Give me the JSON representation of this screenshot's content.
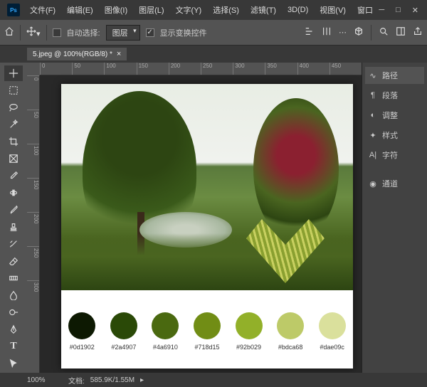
{
  "menu": [
    "文件(F)",
    "编辑(E)",
    "图像(I)",
    "图层(L)",
    "文字(Y)",
    "选择(S)",
    "滤镜(T)",
    "3D(D)",
    "视图(V)",
    "窗口"
  ],
  "optionbar": {
    "auto_select_label": "自动选择:",
    "auto_select_target": "图层",
    "show_transform_label": "显示变换控件"
  },
  "doc_tab": "5.jpeg @ 100%(RGB/8) *",
  "ruler_h": [
    "0",
    "50",
    "100",
    "150",
    "200",
    "250",
    "300",
    "350",
    "400",
    "450"
  ],
  "ruler_v": [
    "0",
    "50",
    "100",
    "150",
    "200",
    "250",
    "300"
  ],
  "palette": [
    {
      "hex": "#0d1902"
    },
    {
      "hex": "#2a4907"
    },
    {
      "hex": "#4a6910"
    },
    {
      "hex": "#718d15"
    },
    {
      "hex": "#92b029"
    },
    {
      "hex": "#bdca68"
    },
    {
      "hex": "#dae09c"
    }
  ],
  "panels": [
    {
      "label": "路径",
      "icon": "∿"
    },
    {
      "label": "段落",
      "icon": "¶"
    },
    {
      "label": "调整",
      "icon": "◐"
    },
    {
      "label": "样式",
      "icon": "✦"
    },
    {
      "label": "字符",
      "icon": "A|"
    },
    {
      "label": "通道",
      "icon": "◉"
    }
  ],
  "status": {
    "zoom": "100%",
    "doc_label": "文档:",
    "doc_size": "585.9K/1.55M"
  },
  "ps_logo": "Ps"
}
